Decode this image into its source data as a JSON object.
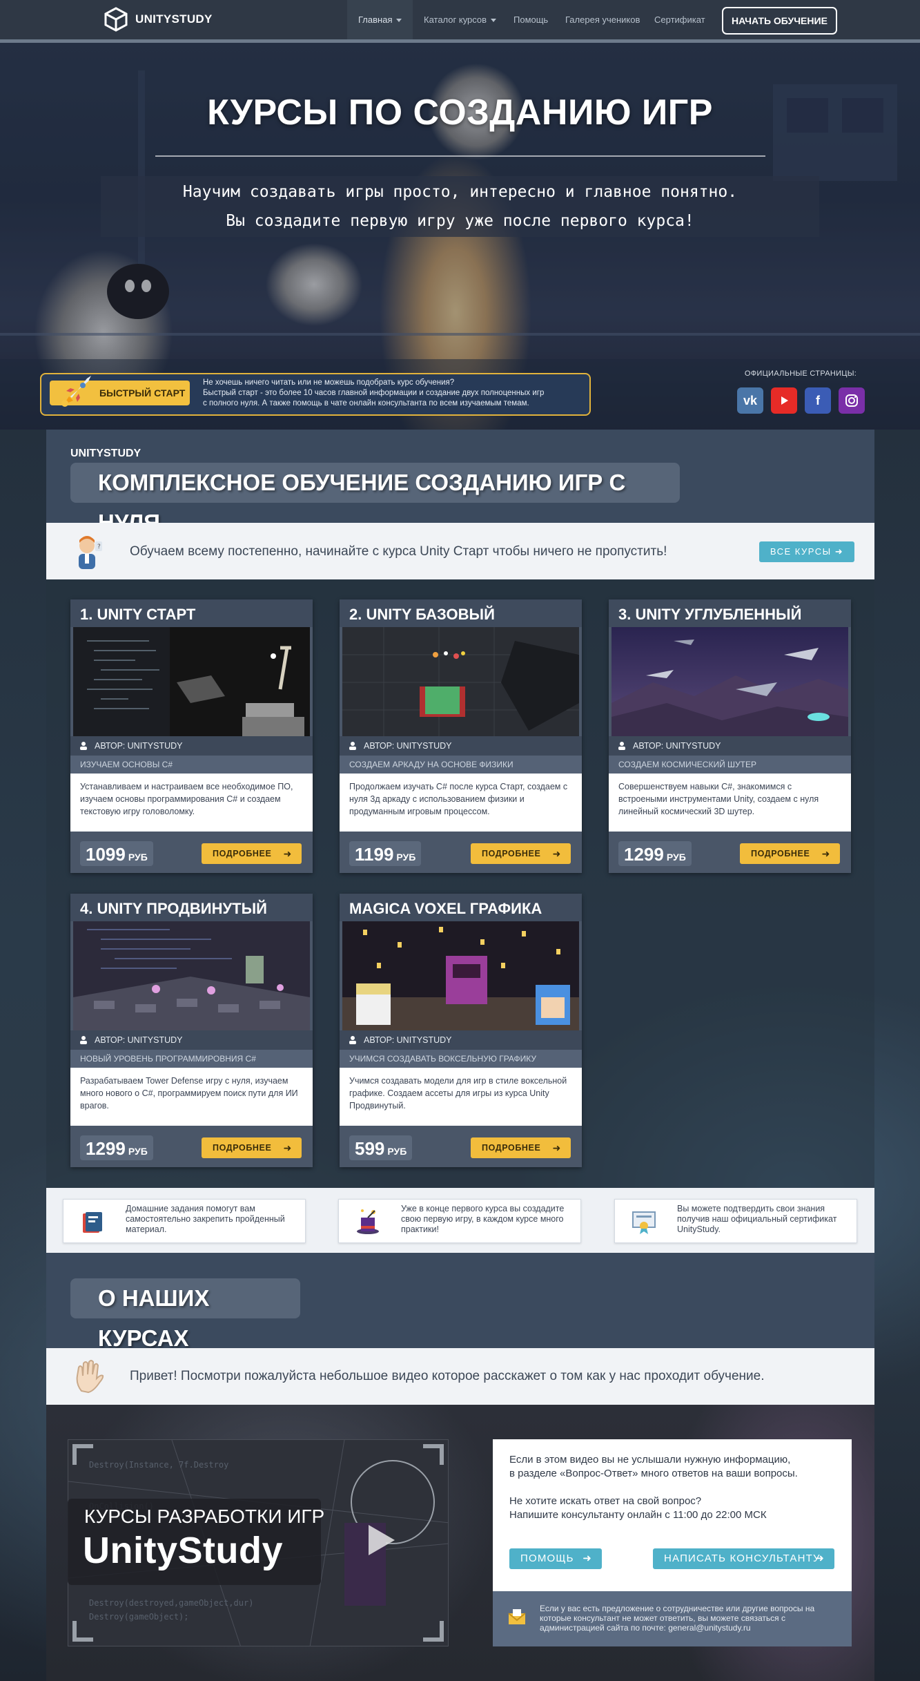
{
  "nav": {
    "brand": "UNITYSTUDY",
    "items": [
      {
        "label": "Главная"
      },
      {
        "label": "Каталог курсов"
      },
      {
        "label": "Помощь"
      },
      {
        "label": "Галерея учеников"
      },
      {
        "label": "Сертификат"
      }
    ],
    "cta": "НАЧАТЬ ОБУЧЕНИЕ"
  },
  "hero": {
    "title": "КУРСЫ ПО СОЗДАНИЮ ИГР",
    "sub1": "Научим создавать игры просто, интересно и главное понятно.",
    "sub2": "Вы создадите первую игру уже после первого курса!"
  },
  "quick": {
    "button": "БЫСТРЫЙ СТАРТ",
    "line1": "Не хочешь ничего читать или не можешь подобрать курс обучения?",
    "line2": "Быстрый старт - это более 10 часов главной информации и создание двух полноценных игр",
    "line3": "с полного нуля. А также помощь в чате онлайн консультанта по всем изучаемым темам."
  },
  "social": {
    "title": "ОФИЦИАЛЬНЫЕ СТРАНИЦЫ:",
    "icons": [
      "vk-icon",
      "youtube-icon",
      "facebook-icon",
      "instagram-icon"
    ]
  },
  "section1": {
    "brand": "UNITYSTUDY",
    "title": "КОМПЛЕКСНОЕ ОБУЧЕНИЕ СОЗДАНИЮ ИГР С НУЛЯ",
    "strip": "Обучаем всему постепенно, начинайте с курса Unity Старт чтобы ничего не пропустить!",
    "all_button": "ВСЕ КУРСЫ"
  },
  "cards": [
    {
      "title": "1. UNITY СТАРТ",
      "author": "АВТОР: UNITYSTUDY",
      "sub": "ИЗУЧАЕМ ОСНОВЫ C#",
      "desc": "Устанавливаем и настраиваем все необходимое ПО, изучаем основы программирования C# и создаем текстовую игру головоломку.",
      "price": "1099",
      "currency": "РУБ",
      "more": "ПОДРОБНЕЕ"
    },
    {
      "title": "2. UNITY БАЗОВЫЙ",
      "author": "АВТОР: UNITYSTUDY",
      "sub": "СОЗДАЕМ АРКАДУ НА ОСНОВЕ ФИЗИКИ",
      "desc": "Продолжаем изучать C# после курса Старт, создаем с нуля 3д аркаду с использованием физики и продуманным игровым процессом.",
      "price": "1199",
      "currency": "РУБ",
      "more": "ПОДРОБНЕЕ"
    },
    {
      "title": "3. UNITY УГЛУБЛЕННЫЙ",
      "author": "АВТОР: UNITYSTUDY",
      "sub": "СОЗДАЕМ КОСМИЧЕСКИЙ ШУТЕР",
      "desc": "Совершенствуем навыки C#, знакомимся с встроеными инструментами Unity, создаем с нуля линейный космический 3D шутер.",
      "price": "1299",
      "currency": "РУБ",
      "more": "ПОДРОБНЕЕ"
    },
    {
      "title": "4. UNITY ПРОДВИНУТЫЙ",
      "author": "АВТОР: UNITYSTUDY",
      "sub": "НОВЫЙ УРОВЕНЬ ПРОГРАММИРОВНИЯ C#",
      "desc": "Разрабатываем Tower Defense игру с нуля, изучаем много нового о C#, программируем поиск пути для ИИ врагов.",
      "price": "1299",
      "currency": "РУБ",
      "more": "ПОДРОБНЕЕ"
    },
    {
      "title": "MAGICA VOXEL ГРАФИКА",
      "author": "АВТОР: UNITYSTUDY",
      "sub": "УЧИМСЯ СОЗДАВАТЬ ВОКСЕЛЬНУЮ ГРАФИКУ",
      "desc": "Учимся создавать модели для игр в стиле воксельной графике. Создаем ассеты для игры из курса Unity Продвинутый.",
      "price": "599",
      "currency": "РУБ",
      "more": "ПОДРОБНЕЕ"
    }
  ],
  "features": [
    {
      "text": "Домашние задания помогут вам самостоятельно закрепить пройденный материал.",
      "icon": "homework-book-icon"
    },
    {
      "text": "Уже в конце первого курса вы создадите свою первую игру, в каждом курсе много практики!",
      "icon": "magic-hat-icon"
    },
    {
      "text": "Вы можете подтвердить свои знания получив наш официальный сертификат UnityStudy.",
      "icon": "certificate-icon"
    }
  ],
  "about": {
    "title": "О НАШИХ КУРСАХ",
    "strip": "Привет! Посмотри пожалуйста небольшое видео которое расскажет о том как у нас проходит обучение."
  },
  "video": {
    "caption1": "КУРСЫ РАЗРАБОТКИ ИГР",
    "caption2": "UnityStudy"
  },
  "info": {
    "p1a": "Если в этом видео вы не услышали нужную информацию,",
    "p1b": "в разделе «Вопрос-Ответ» много ответов на ваши вопросы.",
    "p2a": "Не хотите искать ответ на свой вопрос?",
    "p2b": "Напишите консультанту онлайн с 11:00 до 22:00 МСК",
    "help": "ПОМОЩЬ",
    "write": "НАПИСАТЬ КОНСУЛЬТАНТУ",
    "foot": "Если у вас есть предложение о сотрудничестве или другие вопросы на которые консультант не может ответить, вы можете связаться с администрацией сайта по почте: general@unitystudy.ru"
  },
  "colors": {
    "navbar": "#2f3845",
    "accent_yellow": "#f2bd3c",
    "accent_blue": "#4fb1c9",
    "card": "#4a5668"
  }
}
